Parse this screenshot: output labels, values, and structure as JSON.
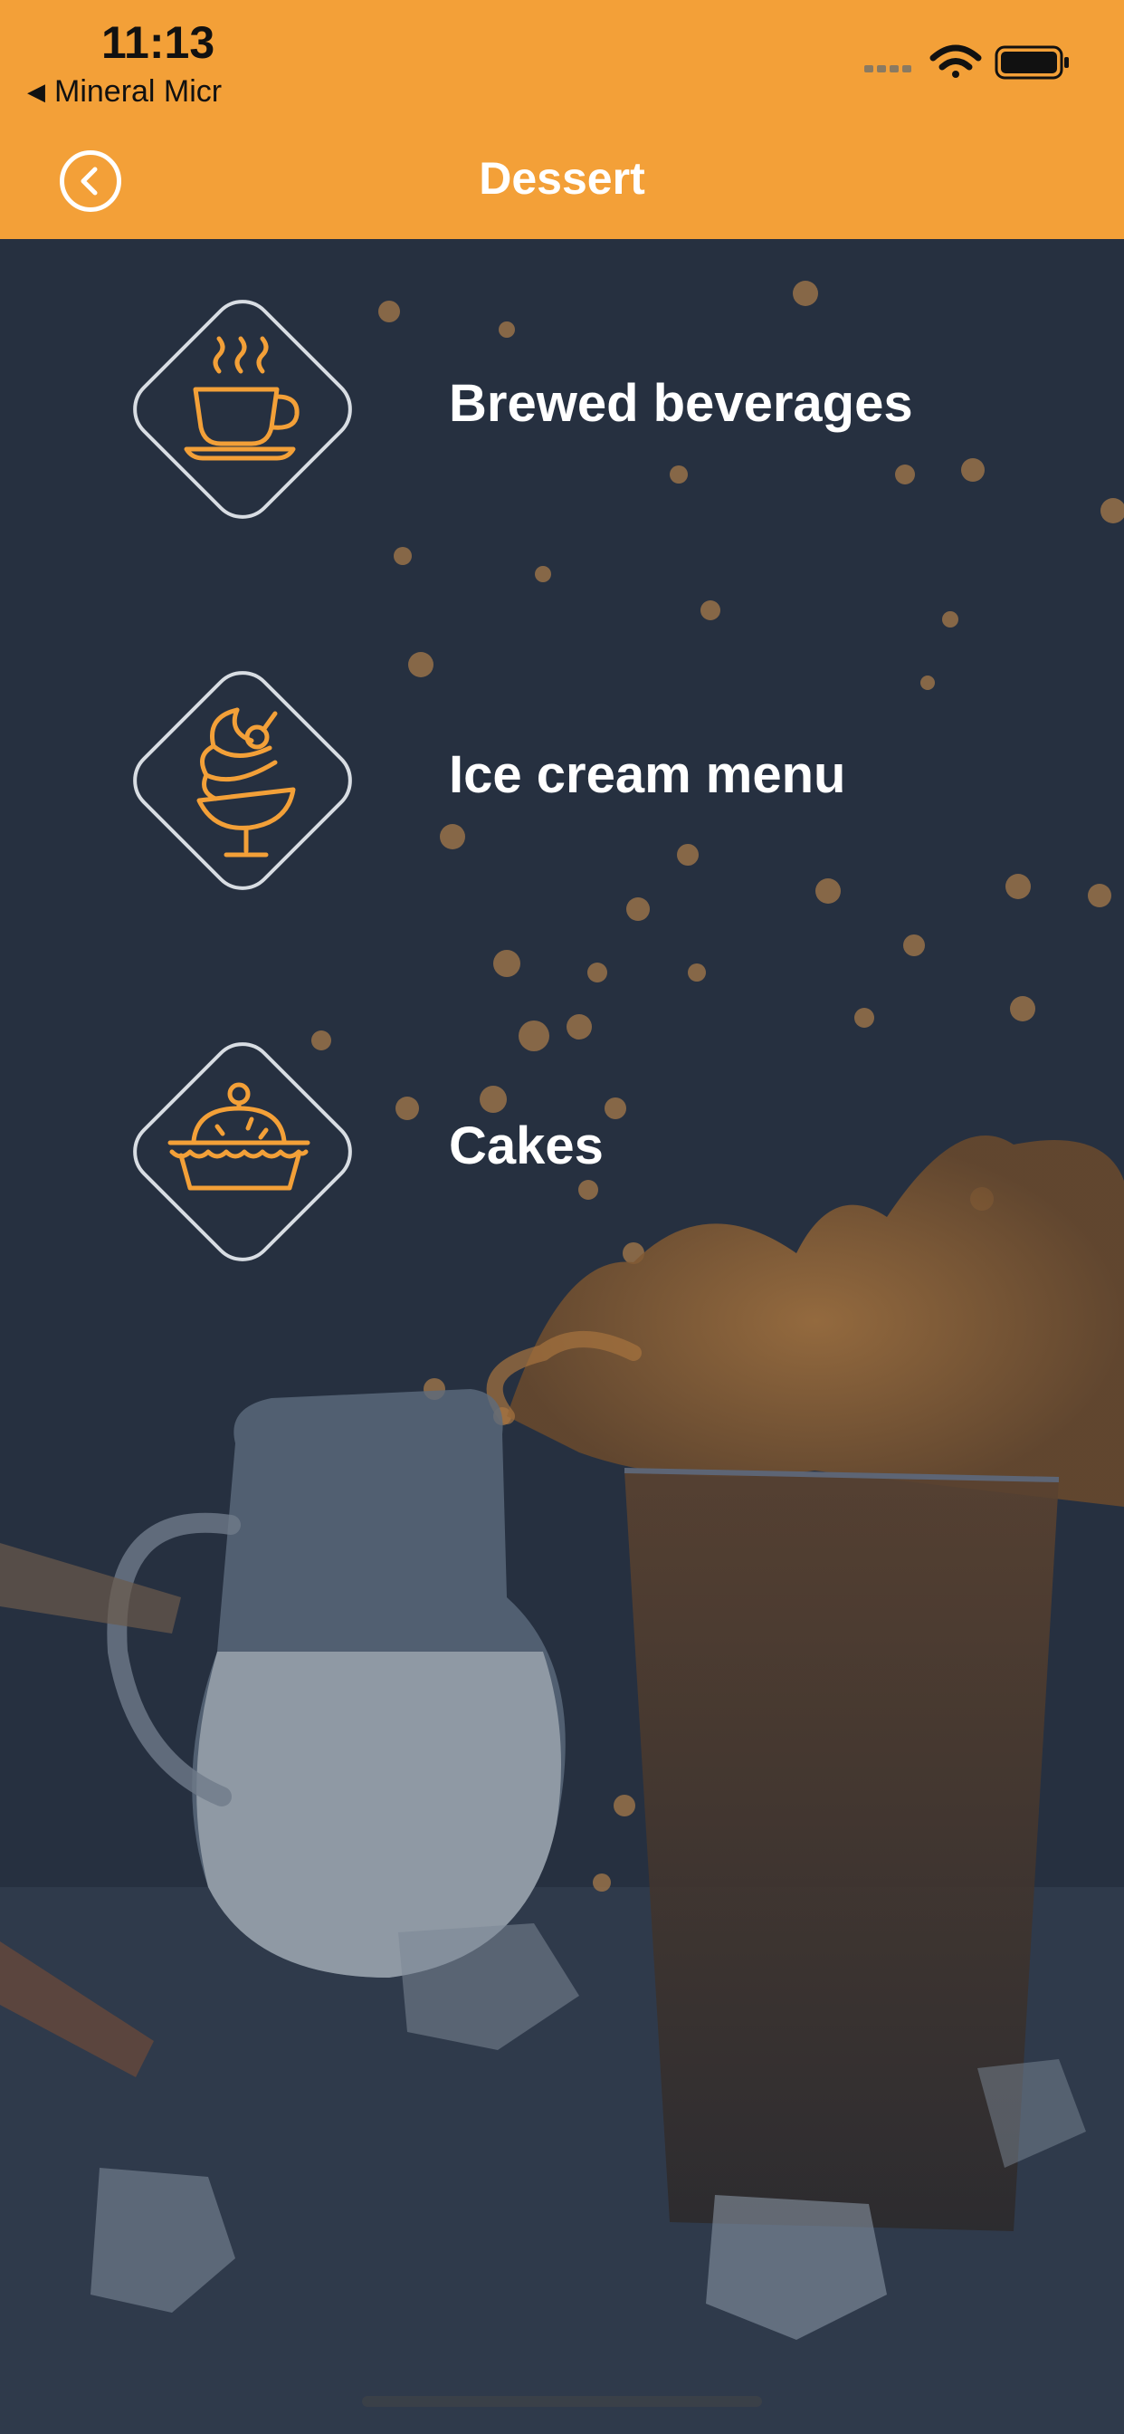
{
  "status_bar": {
    "time": "11:13",
    "back_app_label": "Mineral Micr"
  },
  "nav": {
    "title": "Dessert",
    "back_icon": "circle-chevron-left-icon"
  },
  "menu": {
    "items": [
      {
        "label": "Brewed beverages",
        "icon": "coffee-cup-icon"
      },
      {
        "label": "Ice cream menu",
        "icon": "ice-cream-sundae-icon"
      },
      {
        "label": "Cakes",
        "icon": "pie-icon"
      }
    ]
  },
  "colors": {
    "header": "#f3a038",
    "background": "#263040",
    "icon_accent": "#f3a038",
    "diamond_outline": "#d8dde3",
    "text": "#ffffff"
  }
}
